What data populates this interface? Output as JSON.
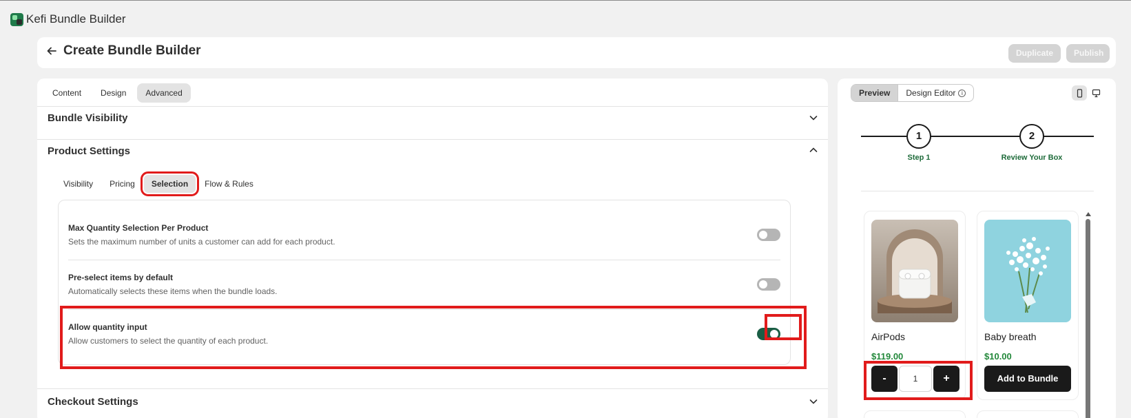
{
  "app": {
    "title": "Kefi Bundle Builder"
  },
  "header": {
    "title": "Create Bundle Builder",
    "duplicate_label": "Duplicate",
    "publish_label": "Publish"
  },
  "tabs": [
    {
      "label": "Content"
    },
    {
      "label": "Design"
    },
    {
      "label": "Advanced",
      "active": true
    }
  ],
  "sections": {
    "bundle_visibility": "Bundle Visibility",
    "product_settings": "Product Settings",
    "checkout_settings": "Checkout Settings"
  },
  "subtabs": [
    {
      "label": "Visibility"
    },
    {
      "label": "Pricing"
    },
    {
      "label": "Selection",
      "active": true
    },
    {
      "label": "Flow & Rules"
    }
  ],
  "settings": [
    {
      "title": "Max Quantity Selection Per Product",
      "description": "Sets the maximum number of units a customer can add for each product.",
      "enabled": false
    },
    {
      "title": "Pre-select items by default",
      "description": "Automatically selects these items when the bundle loads.",
      "enabled": false
    },
    {
      "title": "Allow quantity input",
      "description": "Allow customers to select the quantity of each product.",
      "enabled": true
    }
  ],
  "preview": {
    "view_tabs": {
      "preview": "Preview",
      "design_editor": "Design Editor"
    },
    "steps": [
      {
        "number": "1",
        "label": "Step 1"
      },
      {
        "number": "2",
        "label": "Review Your Box"
      }
    ],
    "products": [
      {
        "name": "AirPods",
        "price": "$119.00",
        "quantity": "1",
        "minus": "-",
        "plus": "+"
      },
      {
        "name": "Baby breath",
        "price": "$10.00",
        "button": "Add to Bundle"
      }
    ]
  },
  "colors": {
    "accent_dark_green": "#1a5e45",
    "step_label_green": "#1e6b3a",
    "price_green": "#22883a",
    "highlight_red": "#e11b1b"
  }
}
